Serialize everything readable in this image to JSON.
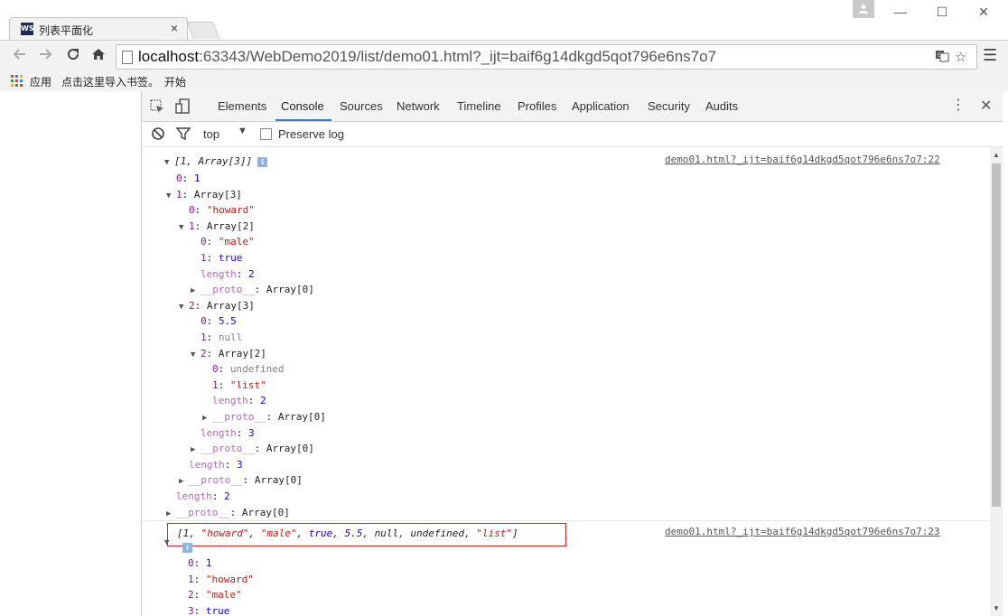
{
  "browser": {
    "tab_title": "列表平面化",
    "tab_favicon": "WS",
    "tab_close": "×",
    "window_minimize": "—",
    "window_maximize": "☐",
    "window_close": "✕",
    "url_host": "localhost",
    "url_rest": ":63343/WebDemo2019/list/demo01.html?_ijt=baif6g14dkgd5qot796e6ns7o7",
    "bookmarks": {
      "apps_label": "应用",
      "import_hint": "点击这里导入书签。",
      "start_label": "开始"
    }
  },
  "devtools": {
    "tabs": [
      "Elements",
      "Console",
      "Sources",
      "Network",
      "Timeline",
      "Profiles",
      "Application",
      "Security",
      "Audits"
    ],
    "active_tab": "Console",
    "context": "top",
    "preserve_log_label": "Preserve log"
  },
  "console": {
    "msg1": {
      "source": "demo01.html?_ijt=baif6g14dkgd5qot796e6ns7o7:22",
      "summary": "[1, Array[3]]",
      "lines": [
        {
          "k": "0",
          "v": "1",
          "t": "n"
        },
        {
          "k": "1",
          "v": "Array[3]",
          "t": "o"
        },
        {
          "k": "0",
          "v": "\"howard\"",
          "t": "s"
        },
        {
          "k": "1",
          "v": "Array[2]",
          "t": "o"
        },
        {
          "k": "0",
          "v": "\"male\"",
          "t": "s"
        },
        {
          "k": "1",
          "v": "true",
          "t": "n"
        },
        {
          "k": "length",
          "v": "2",
          "t": "n"
        },
        {
          "k": "__proto__",
          "v": "Array[0]",
          "t": "o"
        },
        {
          "k": "2",
          "v": "Array[3]",
          "t": "o"
        },
        {
          "k": "0",
          "v": "5.5",
          "t": "n"
        },
        {
          "k": "1",
          "v": "null",
          "t": "g"
        },
        {
          "k": "2",
          "v": "Array[2]",
          "t": "o"
        },
        {
          "k": "0",
          "v": "undefined",
          "t": "g"
        },
        {
          "k": "1",
          "v": "\"list\"",
          "t": "s"
        },
        {
          "k": "length",
          "v": "2",
          "t": "n"
        },
        {
          "k": "__proto__",
          "v": "Array[0]",
          "t": "o"
        },
        {
          "k": "length",
          "v": "3",
          "t": "n"
        },
        {
          "k": "__proto__",
          "v": "Array[0]",
          "t": "o"
        },
        {
          "k": "length",
          "v": "3",
          "t": "n"
        },
        {
          "k": "__proto__",
          "v": "Array[0]",
          "t": "o"
        },
        {
          "k": "length",
          "v": "2",
          "t": "n"
        },
        {
          "k": "__proto__",
          "v": "Array[0]",
          "t": "o"
        }
      ]
    },
    "msg2": {
      "source": "demo01.html?_ijt=baif6g14dkgd5qot796e6ns7o7:23",
      "summary_parts": [
        {
          "text": "[1, ",
          "t": "p"
        },
        {
          "text": "\"howard\"",
          "t": "s"
        },
        {
          "text": ", ",
          "t": "p"
        },
        {
          "text": "\"male\"",
          "t": "s"
        },
        {
          "text": ", ",
          "t": "p"
        },
        {
          "text": "true",
          "t": "n"
        },
        {
          "text": ", ",
          "t": "p"
        },
        {
          "text": "5.5",
          "t": "n"
        },
        {
          "text": ", null, undefined, ",
          "t": "p"
        },
        {
          "text": "\"list\"",
          "t": "s"
        },
        {
          "text": "]",
          "t": "p"
        }
      ],
      "lines": [
        {
          "k": "0",
          "v": "1",
          "t": "n"
        },
        {
          "k": "1",
          "v": "\"howard\"",
          "t": "s"
        },
        {
          "k": "2",
          "v": "\"male\"",
          "t": "s"
        },
        {
          "k": "3",
          "v": "true",
          "t": "n"
        }
      ]
    }
  },
  "icons": [
    "back-arrow-icon",
    "forward-arrow-icon",
    "reload-icon",
    "home-icon",
    "page-icon",
    "translate-icon",
    "star-icon",
    "menu-icon",
    "inspect-icon",
    "device-icon",
    "clear-console-icon",
    "filter-icon",
    "info-icon",
    "user-icon"
  ],
  "colors": {
    "accent": "#3879d9",
    "highlight_border": "#e02020",
    "string": "#c41a16",
    "number": "#1c00cf",
    "key": "#881391"
  }
}
